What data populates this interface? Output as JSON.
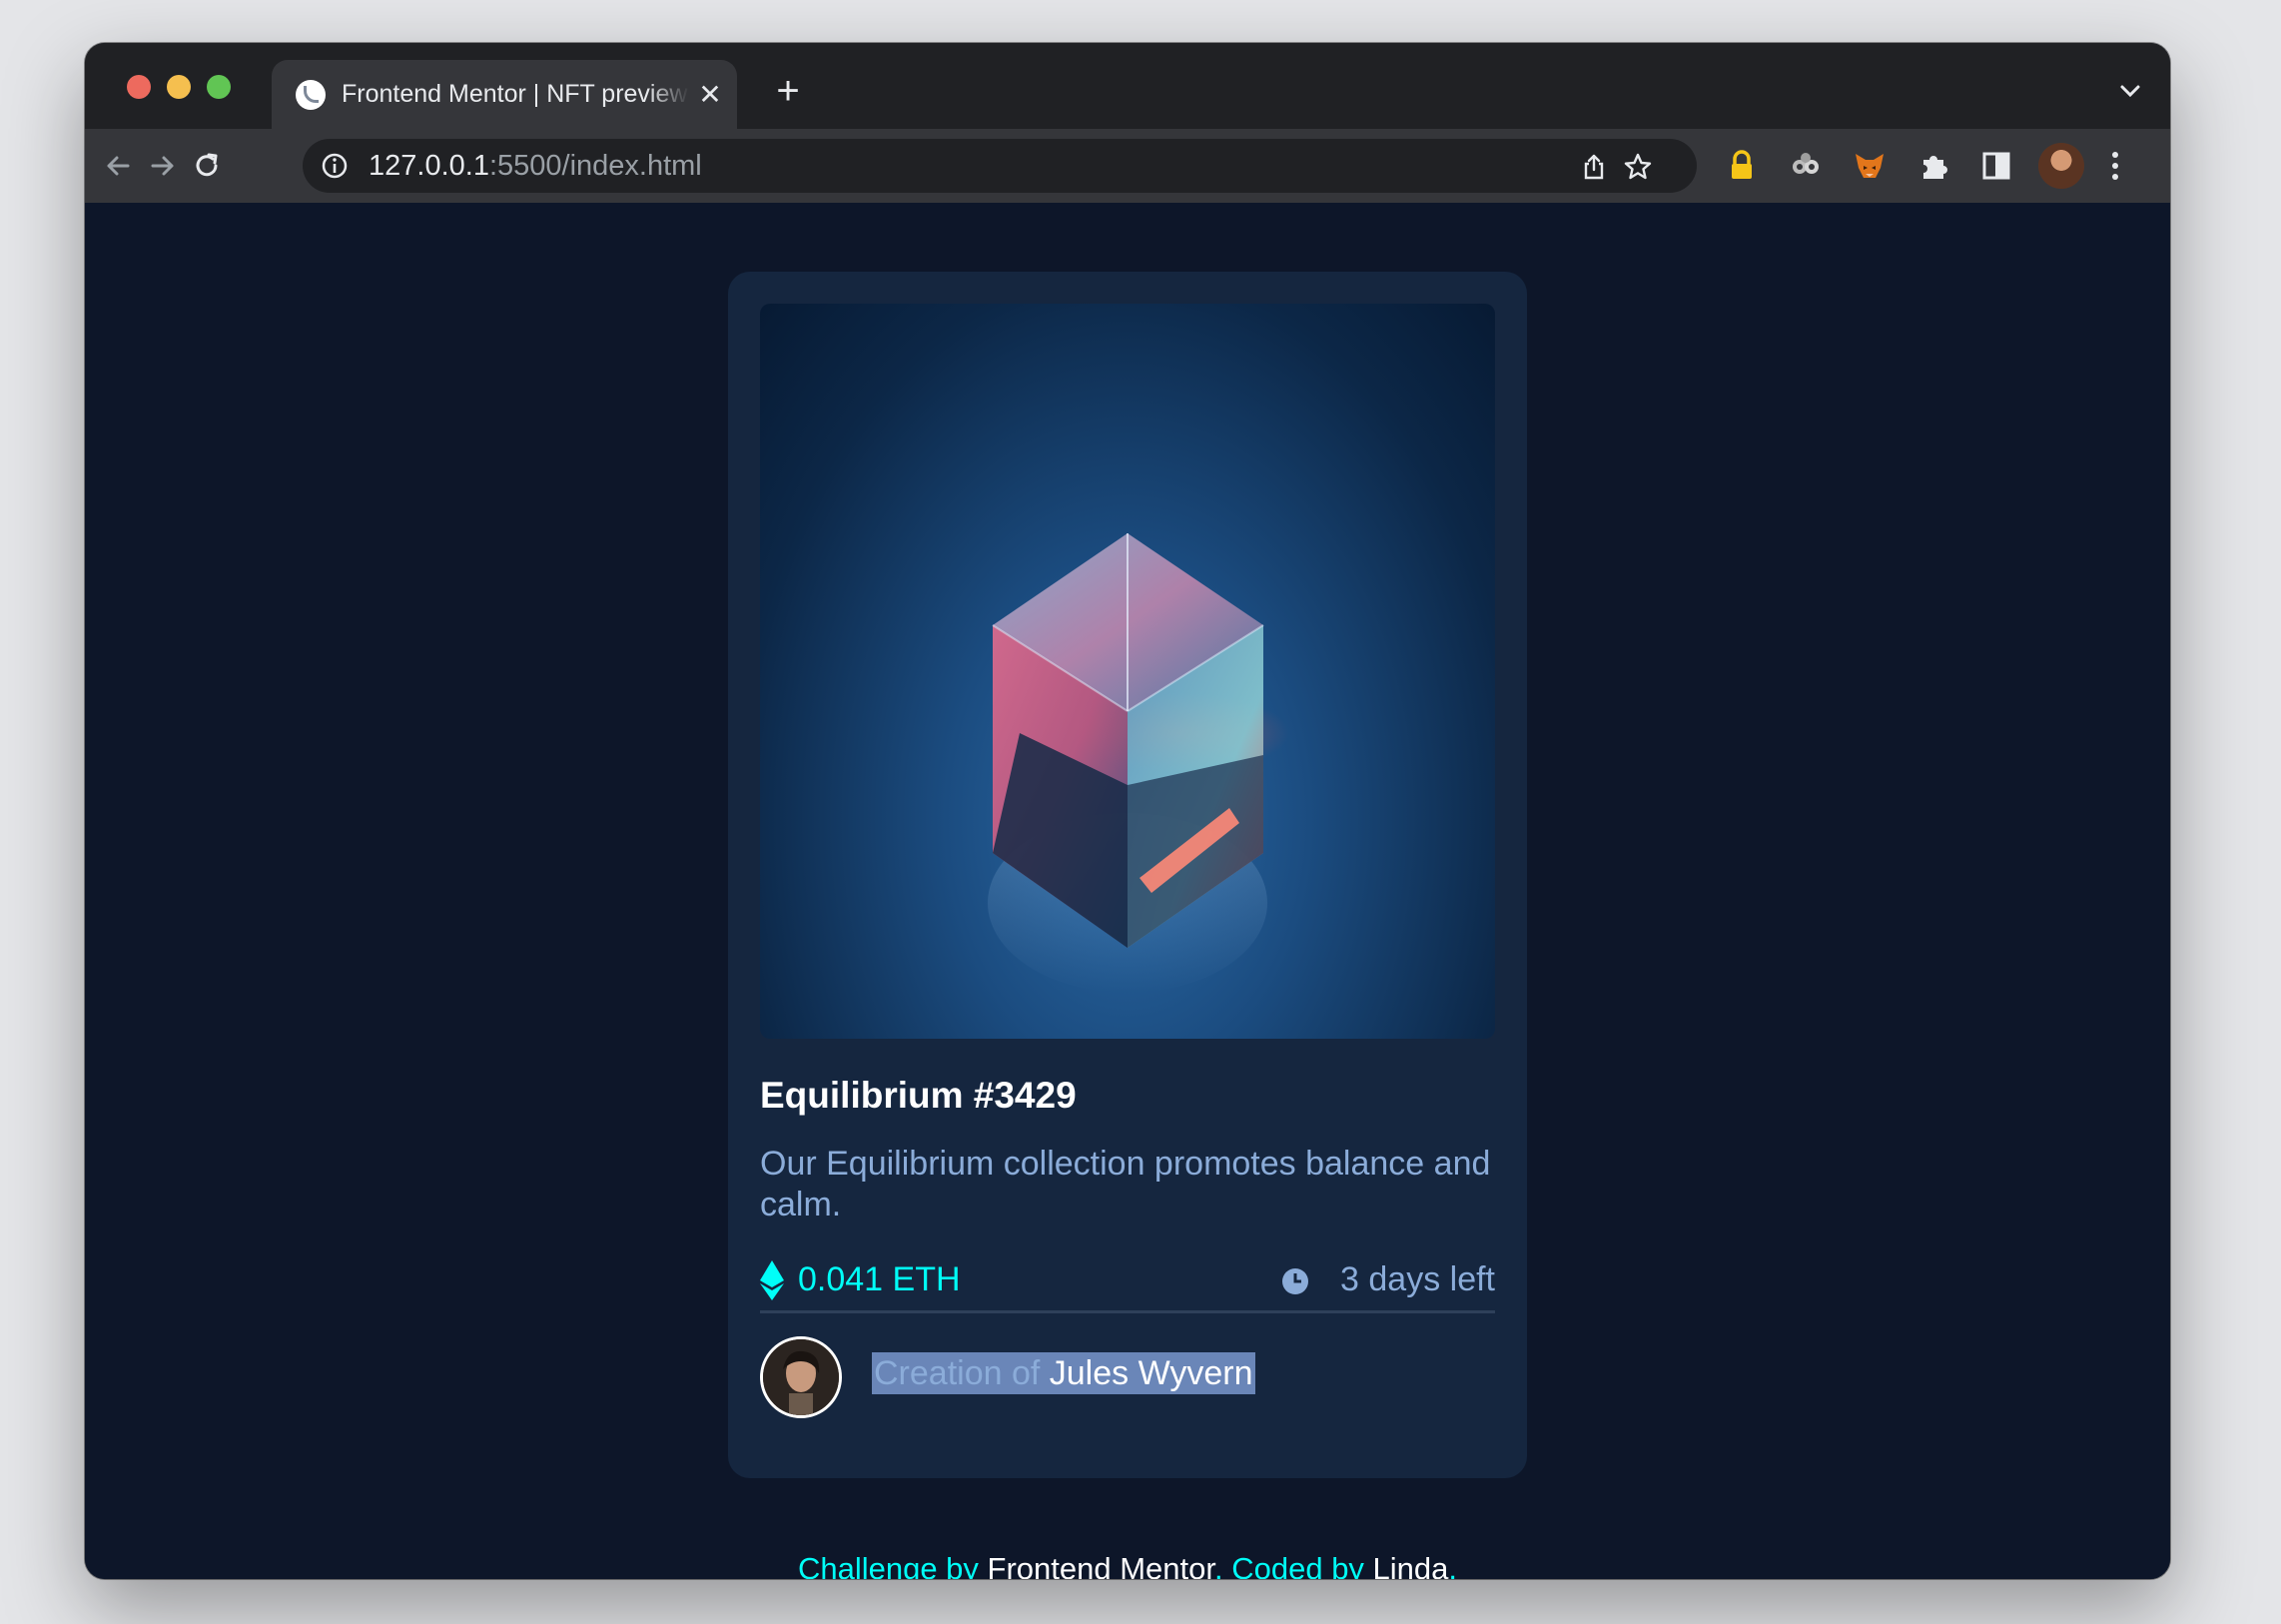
{
  "browser": {
    "tab_title": "Frontend Mentor | NFT preview card component",
    "url_host": "127.0.0.1",
    "url_rest": ":5500/index.html"
  },
  "card": {
    "title": "Equilibrium #3429",
    "description": "Our Equilibrium collection promotes balance and calm.",
    "price": "0.041 ETH",
    "time_left": "3 days left",
    "creator_prefix": "Creation of ",
    "creator_name": "Jules Wyvern"
  },
  "footer": {
    "challenge_prefix": "Challenge by ",
    "challenge_link": "Frontend Mentor",
    "coded_prefix": ". Coded by ",
    "author_link": "Linda",
    "suffix": "."
  },
  "colors": {
    "page_bg": "#0d1629",
    "card_bg": "#15263f",
    "accent_cyan": "#00fff8",
    "soft_blue": "#8bacd9",
    "white": "#ffffff"
  },
  "icons": {
    "back": "arrow-left-icon",
    "forward": "arrow-right-icon",
    "reload": "reload-icon",
    "info": "info-icon",
    "share": "share-icon",
    "bookmark": "star-icon",
    "extensions": [
      "lock-icon",
      "eyes-icon",
      "fox-icon",
      "puzzle-icon",
      "side-panel-icon"
    ],
    "menu": "kebab-menu-icon"
  }
}
